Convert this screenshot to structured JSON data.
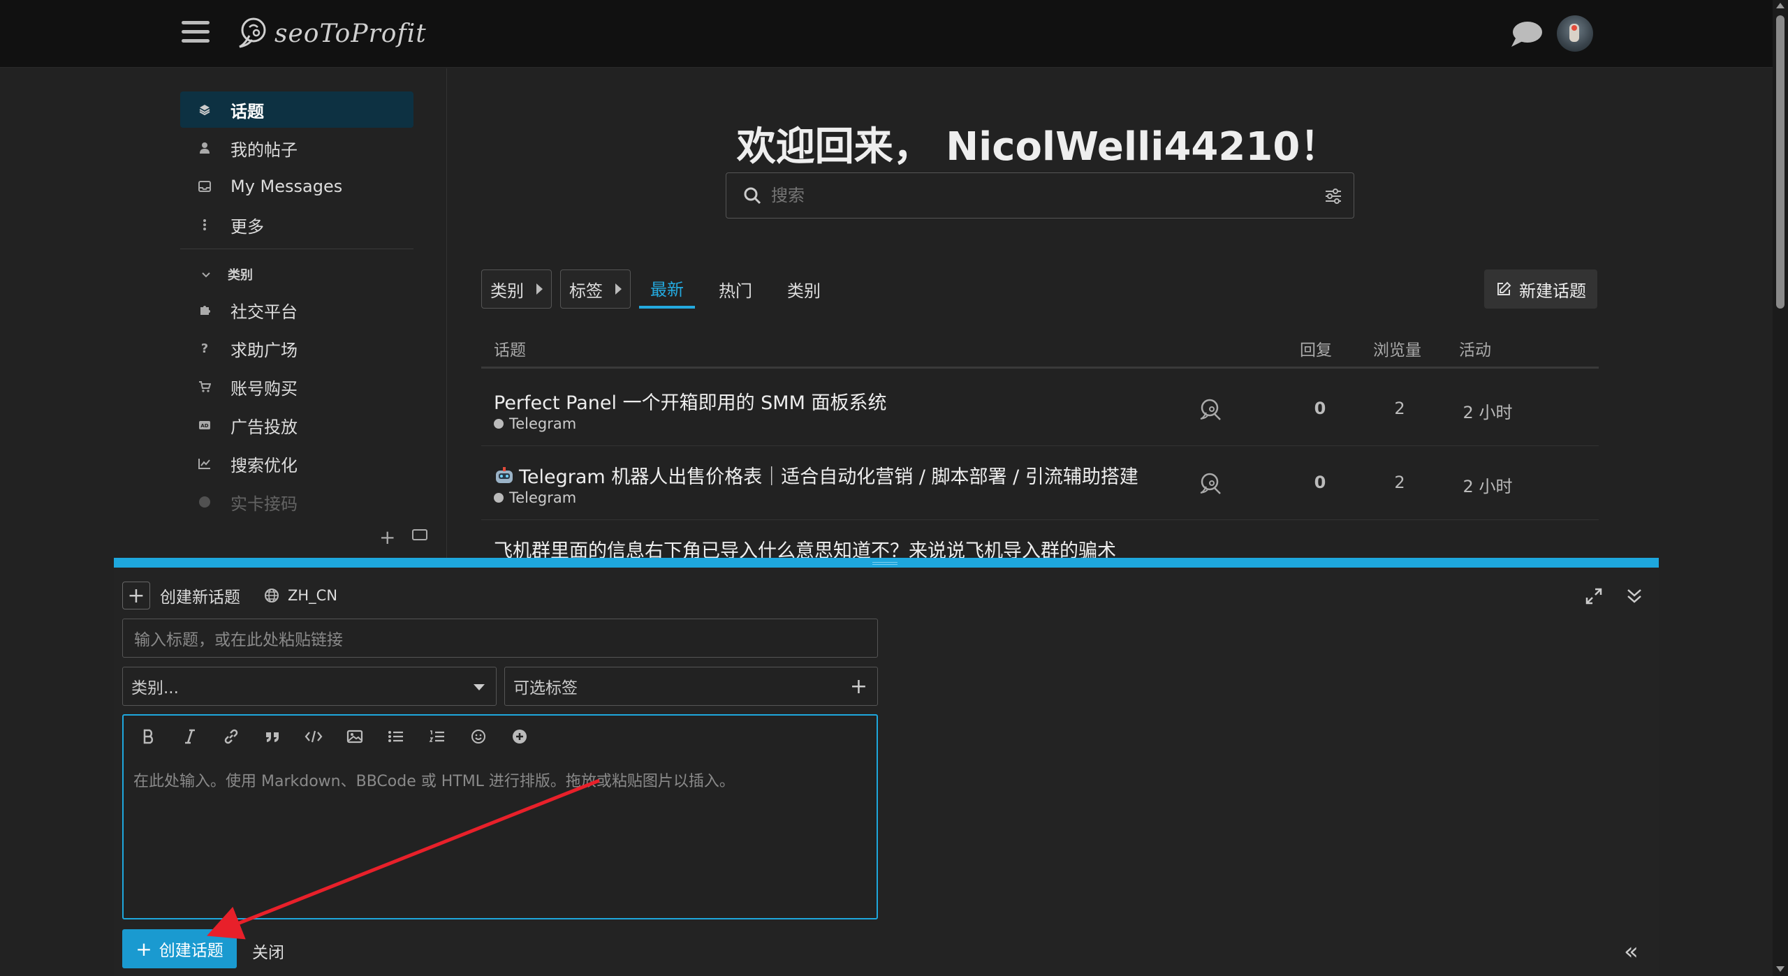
{
  "header": {
    "logo_text": "seoToProfit"
  },
  "sidebar": {
    "items": [
      {
        "label": "话题",
        "icon": "layers-icon"
      },
      {
        "label": "我的帖子",
        "icon": "user-icon"
      },
      {
        "label": "My Messages",
        "icon": "inbox-icon"
      },
      {
        "label": "更多",
        "icon": "more-vertical-icon"
      }
    ],
    "section_label": "类别",
    "categories": [
      {
        "label": "社交平台",
        "icon": "puzzle-icon"
      },
      {
        "label": "求助广场",
        "icon": "question-icon"
      },
      {
        "label": "账号购买",
        "icon": "cart-icon"
      },
      {
        "label": "广告投放",
        "icon": "ad-icon"
      },
      {
        "label": "搜索优化",
        "icon": "chart-line-icon"
      },
      {
        "label": "实卡接码",
        "icon": "circle-icon"
      }
    ]
  },
  "main": {
    "welcome": "欢迎回来， NicolWelli44210！",
    "search_placeholder": "搜索",
    "nav": {
      "category_dropdown": "类别",
      "tag_dropdown": "标签",
      "tabs": [
        "最新",
        "热门",
        "类别"
      ],
      "active_tab": "最新",
      "new_topic": "新建话题"
    },
    "table": {
      "headers": {
        "topic": "话题",
        "replies": "回复",
        "views": "浏览量",
        "activity": "活动"
      },
      "rows": [
        {
          "title": "Perfect Panel 一个开箱即用的 SMM 面板系统",
          "category": "Telegram",
          "replies": "0",
          "views": "2",
          "activity": "2 小时"
        },
        {
          "title": "Telegram 机器人出售价格表｜适合自动化营销 / 脚本部署 / 引流辅助搭建",
          "category": "Telegram",
          "replies": "0",
          "views": "2",
          "activity": "2 小时",
          "emoji": true
        },
        {
          "title": "飞机群里面的信息右下角已导入什么意思知道不？来说说飞机导入群的骗术",
          "category": "",
          "replies": "",
          "views": "",
          "activity": ""
        }
      ]
    }
  },
  "composer": {
    "header_label": "创建新话题",
    "locale": "ZH_CN",
    "title_placeholder": "输入标题，或在此处粘贴链接",
    "category_placeholder": "类别...",
    "tag_placeholder": "可选标签",
    "editor_placeholder": "在此处输入。使用 Markdown、BBCode 或 HTML 进行排版。拖放或粘贴图片以插入。",
    "create_button": "创建话题",
    "close_button": "关闭",
    "toolbar": [
      "bold-icon",
      "italic-icon",
      "link-icon",
      "quote-icon",
      "code-icon",
      "image-icon",
      "bullet-list-icon",
      "numbered-list-icon",
      "emoji-icon",
      "add-circle-icon"
    ]
  },
  "colors": {
    "accent": "#1ea7dd",
    "sidebar_active": "#0d3142",
    "annotation_arrow": "#e8202a"
  }
}
